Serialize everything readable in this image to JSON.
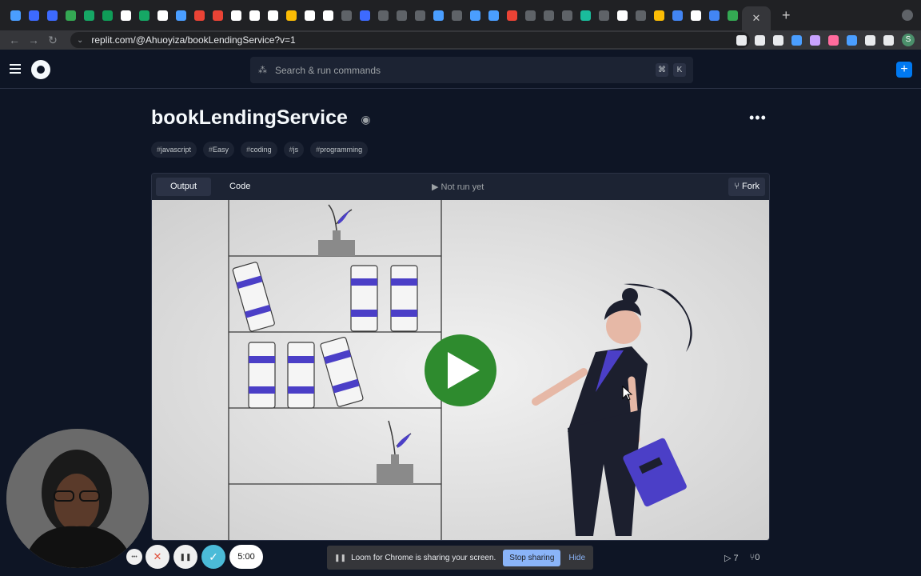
{
  "browser": {
    "tab_favicon_colors": [
      "#4a9eff",
      "#3d6aff",
      "#3d6aff",
      "#34a853",
      "#16a765",
      "#0f9d58",
      "#ffffff",
      "#16a765",
      "#ffffff",
      "#4a9eff",
      "#ea4335",
      "#ea4335",
      "#ffffff",
      "#ffffff",
      "#ffffff",
      "#fbbc05",
      "#ffffff",
      "#ffffff",
      "#5f6368",
      "#3d6aff",
      "#5f6368",
      "#5f6368",
      "#5f6368",
      "#4a9eff",
      "#5f6368",
      "#4a9eff",
      "#4a9eff",
      "#ea4335",
      "#5f6368",
      "#5f6368",
      "#5f6368",
      "#1abc9c",
      "#5f6368",
      "#ffffff",
      "#5f6368",
      "#fbbc05",
      "#4285f4",
      "#ffffff",
      "#4285f4",
      "#34a853"
    ],
    "close_glyph": "✕",
    "new_tab_glyph": "+",
    "url": "replit.com/@Ahuoyiza/bookLendingService?v=1",
    "extension_colors": [
      "#e8eaed",
      "#e8eaed",
      "#e8eaed",
      "#4a9eff",
      "#c8a2ff",
      "#ff6b9d",
      "#4a9eff",
      "#e8eaed",
      "#e8eaed"
    ],
    "profile_initial": "S"
  },
  "header": {
    "search_placeholder": "Search & run commands",
    "shortcut_keys": [
      "⌘",
      "K"
    ],
    "plus_glyph": "+"
  },
  "repl": {
    "title": "bookLendingService",
    "more_glyph": "•••",
    "tags": [
      {
        "hash": "#",
        "label": "javascript"
      },
      {
        "hash": "#",
        "label": "Easy"
      },
      {
        "hash": "#",
        "label": "coding"
      },
      {
        "hash": "#",
        "label": "js"
      },
      {
        "hash": "#",
        "label": "programming"
      }
    ],
    "tabs": [
      "Output",
      "Code"
    ],
    "run_status": "▶ Not run yet",
    "fork_label": "Fork",
    "fork_glyph": "⑂",
    "runs": "7",
    "forks": "0",
    "run_glyph": "▷",
    "fork_count_glyph": "⑂"
  },
  "loom": {
    "timer": "5:00",
    "share_text": "Loom for Chrome is sharing your screen.",
    "stop_label": "Stop sharing",
    "hide_label": "Hide",
    "pause_glyph": "❚❚",
    "more_glyph": "•••",
    "cancel_glyph": "✕",
    "check_glyph": "✓"
  },
  "colors": {
    "accent": "#0079f2",
    "play": "#2e8b2e",
    "book_stripe": "#4b3fc7",
    "figure_dark": "#1c1f2e"
  }
}
